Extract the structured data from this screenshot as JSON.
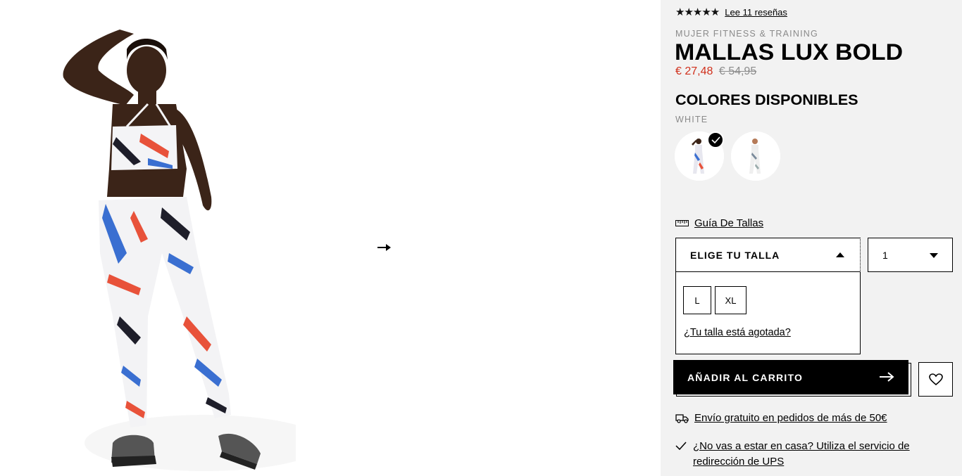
{
  "product": {
    "stars": "★★★★★",
    "reviews_link": "Lee 11 reseñas",
    "category": "MUJER FITNESS & TRAINING",
    "title": "MALLAS LUX BOLD",
    "price_sale": "€ 27,48",
    "price_original": "€ 54,95"
  },
  "colors": {
    "heading": "COLORES DISPONIBLES",
    "selected_name": "WHITE",
    "swatches": [
      {
        "name": "white-multicolor",
        "selected": true
      },
      {
        "name": "white-alt",
        "selected": false
      }
    ]
  },
  "size": {
    "guide_label": "Guía De Tallas",
    "select_label": "ELIGE TU TALLA",
    "options": [
      "L",
      "XL"
    ],
    "soldout_link": "¿Tu talla está agotada?"
  },
  "quantity": {
    "value": "1"
  },
  "cart": {
    "add_label": "AÑADIR AL CARRITO"
  },
  "benefits": {
    "shipping": "Envío gratuito en pedidos de más de 50€",
    "ups": "¿No vas a estar en casa? Utiliza el servicio de redirección de UPS"
  },
  "icons": {
    "gallery_next": "arrow-right-icon",
    "size_guide": "ruler-icon",
    "cart_arrow": "arrow-right-icon",
    "wishlist": "heart-icon",
    "shipping": "truck-icon",
    "ups": "checkmark-icon"
  },
  "colors_palette": {
    "sale_price": "#d0301c",
    "panel_bg": "#f2f2f2",
    "button_bg": "#000000"
  }
}
